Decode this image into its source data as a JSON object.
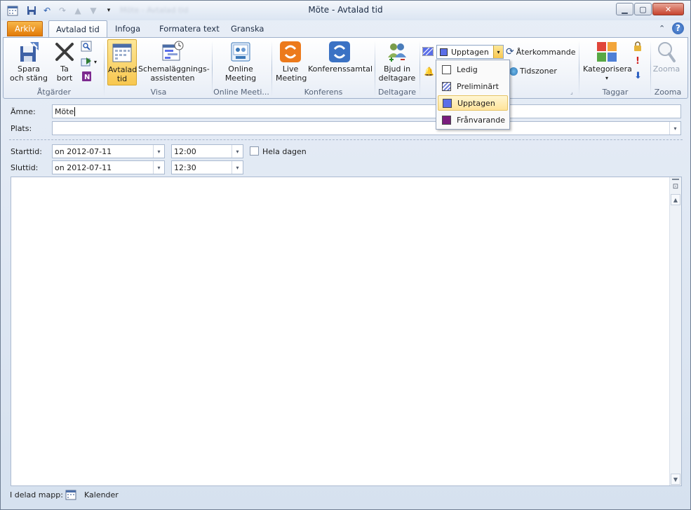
{
  "window": {
    "title": "Möte - Avtalad tid",
    "blurred_title": "Möte - Avtalad tid"
  },
  "qat": [
    "calendar-icon",
    "save-icon",
    "undo-icon",
    "redo-icon",
    "up-arrow-icon",
    "down-arrow-icon",
    "customize-qat-icon"
  ],
  "tabs": {
    "file": "Arkiv",
    "items": [
      "Avtalad tid",
      "Infoga",
      "Formatera text",
      "Granska"
    ]
  },
  "ribbon": {
    "actions": {
      "save_close": [
        "Spara",
        "och stäng"
      ],
      "delete": [
        "Ta",
        "bort"
      ],
      "group": "Åtgärder"
    },
    "show": {
      "appointment": [
        "Avtalad",
        "tid"
      ],
      "scheduling": [
        "Schemaläggnings-",
        "assistenten"
      ],
      "group": "Visa"
    },
    "online_meeting": {
      "btn": [
        "Online",
        "Meeting"
      ],
      "group": "Online Meeti..."
    },
    "conference": {
      "live": [
        "Live",
        "Meeting"
      ],
      "conf": "Konferenssamtal",
      "group": "Konferens"
    },
    "attendees": {
      "invite": [
        "Bjud in",
        "deltagare"
      ],
      "group": "Deltagare"
    },
    "options": {
      "show_as": "Upptagen",
      "recurring": "Återkommande",
      "timezones": "Tidszoner"
    },
    "tags": {
      "categorize": "Kategorisera",
      "group": "Taggar"
    },
    "zoom": {
      "btn": "Zooma",
      "group": "Zooma"
    }
  },
  "form": {
    "subject_label": "Ämne:",
    "subject_value": "Möte",
    "location_label": "Plats:",
    "location_value": "",
    "start_label": "Starttid:",
    "start_date": "on 2012-07-11",
    "start_time": "12:00",
    "allday_label": "Hela dagen",
    "end_label": "Sluttid:",
    "end_date": "on 2012-07-11",
    "end_time": "12:30"
  },
  "status": {
    "folder_label": "I delad mapp:",
    "folder_value": "Kalender"
  },
  "show_as_menu": {
    "items": [
      {
        "label": "Ledig",
        "color": "#ffffff"
      },
      {
        "label": "Preliminärt",
        "color": "#6f7fd6"
      },
      {
        "label": "Upptagen",
        "color": "#5a6ee8"
      },
      {
        "label": "Frånvarande",
        "color": "#7a1d7e"
      }
    ],
    "selected": "Upptagen"
  },
  "colors": {
    "file_tab": "#e27a08",
    "busy_blue": "#5a6ee8",
    "selection": "#ffe49a"
  }
}
